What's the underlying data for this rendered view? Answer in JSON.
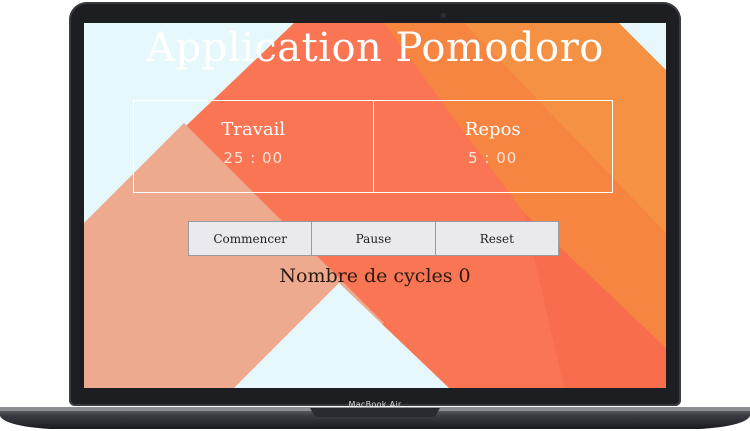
{
  "app": {
    "title": "Application Pomodoro"
  },
  "timers": {
    "work": {
      "label": "Travail",
      "value": "25 : 00"
    },
    "rest": {
      "label": "Repos",
      "value": "5 : 00"
    }
  },
  "controls": {
    "start_label": "Commencer",
    "pause_label": "Pause",
    "reset_label": "Reset"
  },
  "cycles": {
    "label": "Nombre de cycles",
    "count": "0"
  },
  "device": {
    "model_label": "MacBook Air"
  },
  "colors": {
    "accent_orange": "#f97553",
    "light_cyan": "#e6f8fb",
    "salmon": "#eeaa8e",
    "button_bg": "#e9e9ee"
  }
}
